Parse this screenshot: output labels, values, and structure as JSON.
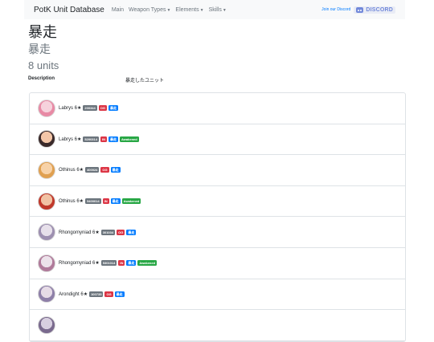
{
  "navbar": {
    "brand": "PotK Unit Database",
    "items": [
      {
        "label": "Main",
        "dropdown": false
      },
      {
        "label": "Weapon Types",
        "dropdown": true
      },
      {
        "label": "Elements",
        "dropdown": true
      },
      {
        "label": "Skills",
        "dropdown": true
      }
    ],
    "join_text": "Join our Discord",
    "discord_label": "DISCORD"
  },
  "page": {
    "title": "暴走",
    "subtitle": "暴走",
    "count": "8 units",
    "description_label": "Description",
    "description_value": "暴走したユニット"
  },
  "units": [
    {
      "name": "Labrys 6★",
      "id": "200344",
      "type": "OG",
      "element": "暴走",
      "awakened": "",
      "colors": [
        "#f6d2dc",
        "#e88aa5"
      ]
    },
    {
      "name": "Labrys 6★",
      "id": "5200314",
      "type": "IN",
      "element": "暴走",
      "awakened": "Awakened",
      "colors": [
        "#f3c6a8",
        "#3a2a2a"
      ]
    },
    {
      "name": "Othinus 6★",
      "id": "400024",
      "type": "OG",
      "element": "暴走",
      "awakened": "",
      "colors": [
        "#f7d2a8",
        "#e0a050"
      ]
    },
    {
      "name": "Othinus 6★",
      "id": "5400014",
      "type": "IN",
      "element": "暴走",
      "awakened": "Awakened",
      "colors": [
        "#f1c2a4",
        "#c0392b"
      ]
    },
    {
      "name": "Rhongomyniad 6★",
      "id": "301034",
      "type": "OG",
      "element": "暴走",
      "awakened": "",
      "colors": [
        "#e7e0ea",
        "#9d8fb0"
      ]
    },
    {
      "name": "Rhongomyniad 6★",
      "id": "5301014",
      "type": "IN",
      "element": "暴走",
      "awakened": "Awakened",
      "colors": [
        "#ece2ea",
        "#b07a9a"
      ]
    },
    {
      "name": "Arondight 6★",
      "id": "100735",
      "type": "OG",
      "element": "暴走",
      "awakened": "",
      "colors": [
        "#e6dbe6",
        "#8e7fa8"
      ]
    },
    {
      "name": "",
      "id": "",
      "type": "",
      "element": "",
      "awakened": "",
      "colors": [
        "#d8cfe0",
        "#7a6a8e"
      ]
    }
  ]
}
